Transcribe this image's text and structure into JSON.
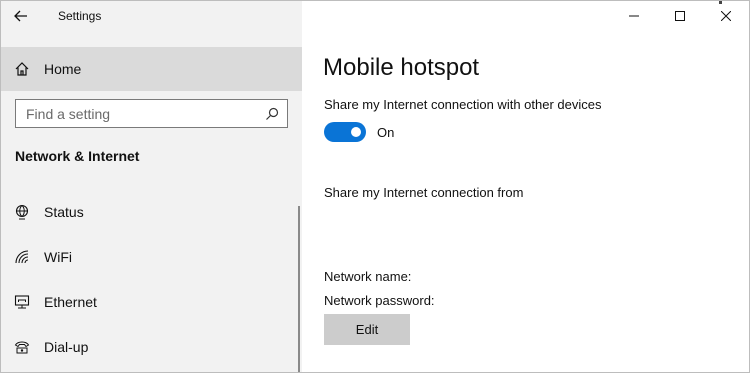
{
  "window": {
    "title": "Settings",
    "controls": [
      "minimize",
      "maximize",
      "close"
    ]
  },
  "sidebar": {
    "home_label": "Home",
    "search_placeholder": "Find a setting",
    "section_heading": "Network & Internet",
    "items": [
      {
        "label": "Status",
        "icon": "globe-icon"
      },
      {
        "label": "WiFi",
        "icon": "wifi-icon"
      },
      {
        "label": "Ethernet",
        "icon": "ethernet-icon"
      },
      {
        "label": "Dial-up",
        "icon": "dialup-icon"
      }
    ]
  },
  "main": {
    "title": "Mobile hotspot",
    "share_description": "Share my Internet connection with other devices",
    "toggle": {
      "state": "On",
      "on": true
    },
    "share_from_label": "Share my Internet connection from",
    "network_name_label": "Network name:",
    "network_password_label": "Network password:",
    "edit_label": "Edit"
  },
  "colors": {
    "accent": "#0a74d6",
    "sidebar_bg": "#f2f2f2",
    "selected_bg": "#dadada",
    "button_bg": "#cccccc"
  }
}
